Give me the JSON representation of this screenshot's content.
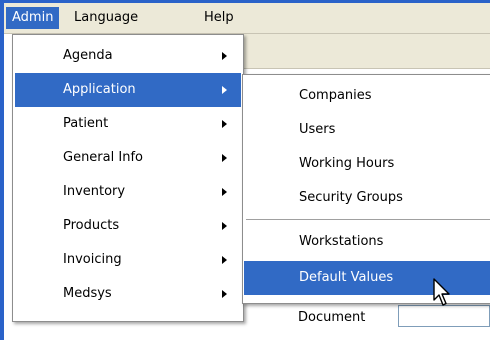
{
  "menubar": {
    "items": [
      {
        "label": "Admin"
      },
      {
        "label": "Language"
      },
      {
        "label": "Help"
      }
    ]
  },
  "admin_menu": {
    "items": [
      {
        "label": "Agenda"
      },
      {
        "label": "Application"
      },
      {
        "label": "Patient"
      },
      {
        "label": "General Info"
      },
      {
        "label": "Inventory"
      },
      {
        "label": "Products"
      },
      {
        "label": "Invoicing"
      },
      {
        "label": "Medsys"
      }
    ]
  },
  "application_submenu": {
    "items": [
      {
        "label": "Companies"
      },
      {
        "label": "Users"
      },
      {
        "label": "Working Hours"
      },
      {
        "label": "Security Groups"
      },
      {
        "label": "Workstations"
      },
      {
        "label": "Default Values"
      }
    ]
  },
  "form": {
    "document_label": "Document",
    "document_value": ""
  },
  "colors": {
    "highlight": "#316ac5",
    "menubar_bg": "#ece9d8",
    "window_border": "#2a62c9"
  },
  "icons": {
    "submenu_arrow": "chevron-right-icon",
    "cursor": "mouse-pointer-icon"
  }
}
